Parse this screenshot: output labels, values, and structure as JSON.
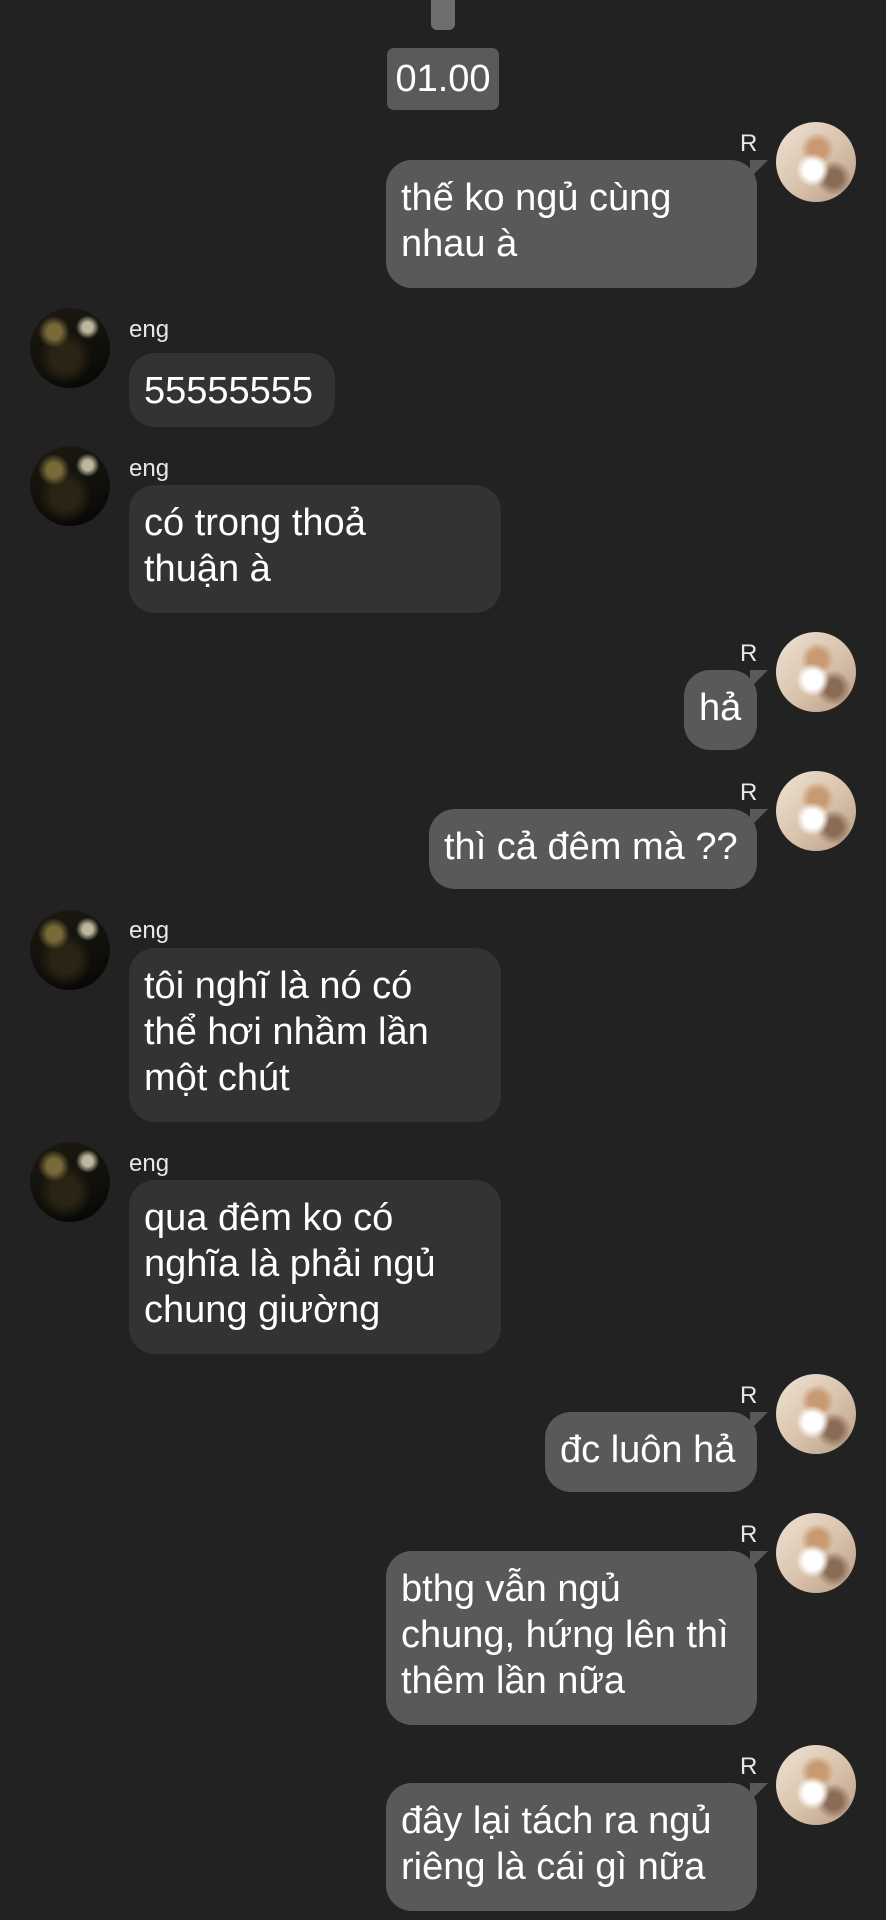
{
  "timestamp": "01.00",
  "messages": [
    {
      "side": "out",
      "sender": "R",
      "text": "thế ko ngủ cùng\nnhau à"
    },
    {
      "side": "in",
      "sender": "eng",
      "text": "55555555"
    },
    {
      "side": "in",
      "sender": "eng",
      "text": "có trong thoả\nthuận à"
    },
    {
      "side": "out",
      "sender": "R",
      "text": "hả"
    },
    {
      "side": "out",
      "sender": "R",
      "text": "thì cả đêm mà ??"
    },
    {
      "side": "in",
      "sender": "eng",
      "text": "tôi nghĩ là nó có\nthể hơi nhầm lần\nmột chút"
    },
    {
      "side": "in",
      "sender": "eng",
      "text": "qua đêm ko có\nnghĩa là phải ngủ\nchung giường"
    },
    {
      "side": "out",
      "sender": "R",
      "text": "đc luôn hả"
    },
    {
      "side": "out",
      "sender": "R",
      "text": "bthg vẫn ngủ\nchung, hứng lên thì\nthêm lần nữa"
    },
    {
      "side": "out",
      "sender": "R",
      "text": "đây lại tách ra ngủ\nriêng là cái gì nữa"
    }
  ]
}
